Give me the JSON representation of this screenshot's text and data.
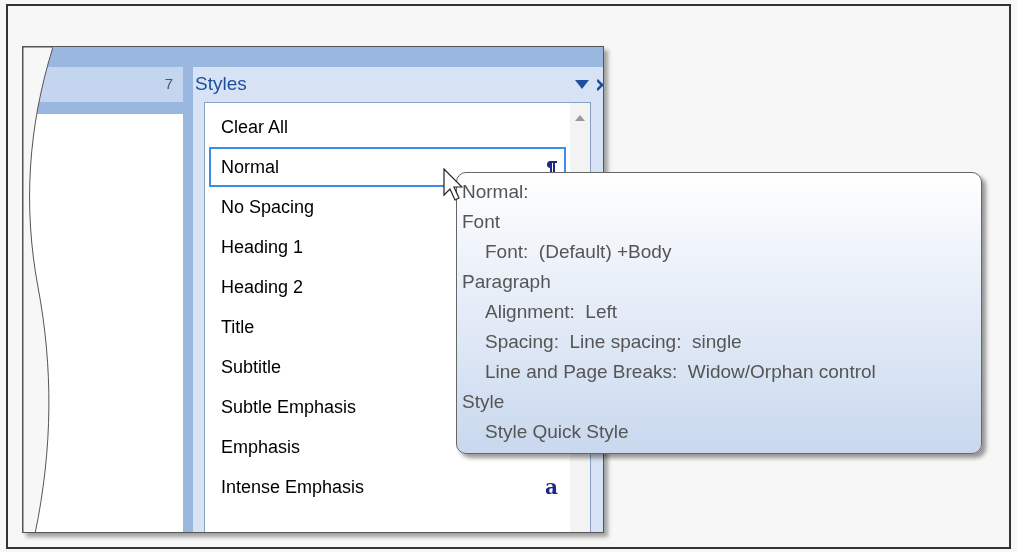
{
  "ruler": {
    "number": "7"
  },
  "styles_pane": {
    "title": "Styles",
    "items": [
      {
        "label": "Clear All",
        "selected": false,
        "kind": "none"
      },
      {
        "label": "Normal",
        "selected": true,
        "kind": "paragraph"
      },
      {
        "label": "No Spacing",
        "selected": false,
        "kind": "none"
      },
      {
        "label": "Heading 1",
        "selected": false,
        "kind": "none"
      },
      {
        "label": "Heading 2",
        "selected": false,
        "kind": "none"
      },
      {
        "label": "Title",
        "selected": false,
        "kind": "none"
      },
      {
        "label": "Subtitle",
        "selected": false,
        "kind": "none"
      },
      {
        "label": "Subtle Emphasis",
        "selected": false,
        "kind": "none"
      },
      {
        "label": "Emphasis",
        "selected": false,
        "kind": "none"
      },
      {
        "label": "Intense Emphasis",
        "selected": false,
        "kind": "character",
        "mark": "a"
      }
    ]
  },
  "tooltip": {
    "title": "Normal:",
    "sections": [
      {
        "heading": "Font",
        "children": [
          "Font:  (Default) +Body"
        ]
      },
      {
        "heading": "Paragraph",
        "children": [
          "Alignment:  Left",
          "Spacing:  Line spacing:  single",
          "Line and Page Breaks:  Widow/Orphan control"
        ]
      },
      {
        "heading": "Style",
        "children": [
          "Style Quick Style"
        ]
      }
    ]
  }
}
